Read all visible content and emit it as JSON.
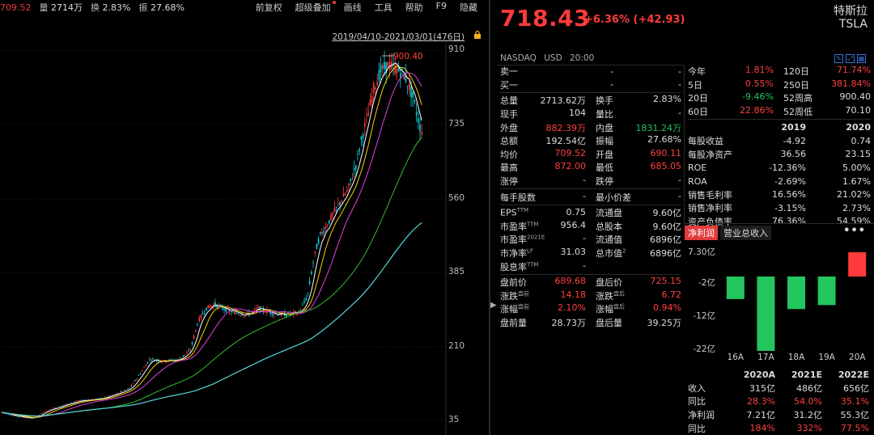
{
  "top_stats": [
    {
      "label": "",
      "value": "709.52",
      "tone": "red"
    },
    {
      "label": "量",
      "value": "2714万",
      "tone": "white"
    },
    {
      "label": "换",
      "value": "2.83%",
      "tone": "white"
    },
    {
      "label": "振",
      "value": "27.68%",
      "tone": "white"
    }
  ],
  "toolbar": [
    "前复权",
    "超级叠加",
    "画线",
    "工具",
    "帮助",
    "F9",
    "隐藏"
  ],
  "date_range": "2019/04/10-2021/03/01(476日)",
  "peak_label": "900.40",
  "price_axis": [
    "910",
    "735",
    "560",
    "385",
    "210",
    "35"
  ],
  "quote": {
    "price": "718.43",
    "change": "+6.36% (+42.93)",
    "name_cn": "特斯拉",
    "ticker": "TSLA",
    "exchange": "NASDAQ",
    "currency": "USD",
    "time": "20:00"
  },
  "icons_right": [
    "edit-icon",
    "chart-icon",
    "settings-icon"
  ],
  "bid_ask": [
    {
      "label": "卖一",
      "v1": "-",
      "v2": "-"
    },
    {
      "label": "买一",
      "v1": "-",
      "v2": "-"
    }
  ],
  "stats_left": [
    [
      {
        "l": "总量",
        "v": "2713.62万",
        "t": "white"
      },
      {
        "l": "换手",
        "v": "2.83%",
        "t": "white"
      }
    ],
    [
      {
        "l": "现手",
        "v": "104",
        "t": "white"
      },
      {
        "l": "量比",
        "v": "-",
        "t": "white"
      }
    ],
    [
      {
        "l": "外盘",
        "v": "882.39万",
        "t": "red"
      },
      {
        "l": "内盘",
        "v": "1831.24万",
        "t": "green"
      }
    ],
    [
      {
        "l": "总额",
        "v": "192.54亿",
        "t": "white"
      },
      {
        "l": "振幅",
        "v": "27.68%",
        "t": "white"
      }
    ],
    [
      {
        "l": "均价",
        "v": "709.52",
        "t": "red"
      },
      {
        "l": "开盘",
        "v": "690.11",
        "t": "red"
      }
    ],
    [
      {
        "l": "最高",
        "v": "872.00",
        "t": "red"
      },
      {
        "l": "最低",
        "v": "685.05",
        "t": "red"
      }
    ],
    [
      {
        "l": "涨停",
        "v": "-",
        "t": "white"
      },
      {
        "l": "跌停",
        "v": "-",
        "t": "white"
      }
    ]
  ],
  "lot_row": [
    {
      "l": "每手股数",
      "v": "-",
      "t": "white"
    },
    {
      "l": "最小价差",
      "v": "-",
      "t": "white"
    }
  ],
  "fund_rows": [
    [
      {
        "l": "EPS",
        "sup": "TTM",
        "v": "0.75",
        "t": "white"
      },
      {
        "l": "流通盘",
        "sup": "",
        "v": "9.60亿",
        "t": "white"
      }
    ],
    [
      {
        "l": "市盈率",
        "sup": "TTM",
        "v": "956.4",
        "t": "white"
      },
      {
        "l": "总股本",
        "sup": "",
        "v": "9.60亿",
        "t": "white"
      }
    ],
    [
      {
        "l": "市盈率",
        "sup": "2021E",
        "v": "-",
        "t": "white"
      },
      {
        "l": "流通值",
        "sup": "",
        "v": "6896亿",
        "t": "white"
      }
    ],
    [
      {
        "l": "市净率",
        "sup": "LF",
        "v": "31.03",
        "t": "white"
      },
      {
        "l": "总市值",
        "sup": "2",
        "v": "6896亿",
        "t": "white"
      }
    ],
    [
      {
        "l": "股息率",
        "sup": "TTM",
        "v": "-",
        "t": "white"
      },
      {
        "l": "",
        "sup": "",
        "v": "",
        "t": "white"
      }
    ]
  ],
  "extended_rows": [
    [
      {
        "l": "盘前价",
        "sup": "",
        "v": "689.68",
        "t": "red"
      },
      {
        "l": "盘后价",
        "sup": "",
        "v": "725.15",
        "t": "red"
      }
    ],
    [
      {
        "l": "涨跌",
        "sup": "盘前",
        "v": "14.18",
        "t": "red"
      },
      {
        "l": "涨跌",
        "sup": "盘后",
        "v": "6.72",
        "t": "red"
      }
    ],
    [
      {
        "l": "涨幅",
        "sup": "盘前",
        "v": "2.10%",
        "t": "red"
      },
      {
        "l": "涨幅",
        "sup": "盘后",
        "v": "0.94%",
        "t": "red"
      }
    ],
    [
      {
        "l": "盘前量",
        "sup": "",
        "v": "28.73万",
        "t": "white"
      },
      {
        "l": "盘后量",
        "sup": "",
        "v": "39.25万",
        "t": "white"
      }
    ]
  ],
  "perf_rows": [
    [
      {
        "l": "今年",
        "v": "1.81%",
        "t": "red"
      },
      {
        "l": "120日",
        "v": "71.74%",
        "t": "red"
      }
    ],
    [
      {
        "l": "5日",
        "v": "0.55%",
        "t": "red"
      },
      {
        "l": "250日",
        "v": "381.84%",
        "t": "red"
      }
    ],
    [
      {
        "l": "20日",
        "v": "-9.46%",
        "t": "green"
      },
      {
        "l": "52周高",
        "v": "900.40",
        "t": "white"
      }
    ],
    [
      {
        "l": "60日",
        "v": "22.86%",
        "t": "red"
      },
      {
        "l": "52周低",
        "v": "70.10",
        "t": "white"
      }
    ]
  ],
  "fin_table": {
    "years": [
      "2019",
      "2020"
    ],
    "rows": [
      {
        "l": "每股收益",
        "a": "-4.92",
        "b": "0.74"
      },
      {
        "l": "每股净资产",
        "a": "36.56",
        "b": "23.15"
      },
      {
        "l": "ROE",
        "a": "-12.36%",
        "b": "5.00%"
      },
      {
        "l": "ROA",
        "a": "-2.69%",
        "b": "1.67%"
      },
      {
        "l": "销售毛利率",
        "a": "16.56%",
        "b": "21.02%"
      },
      {
        "l": "销售净利率",
        "a": "-3.15%",
        "b": "2.73%"
      },
      {
        "l": "资产负债率",
        "a": "76.36%",
        "b": "54.59%"
      }
    ]
  },
  "fin_tabs": [
    "净利润",
    "营业总收入"
  ],
  "more_label": "•••",
  "chart_data": {
    "type": "bar",
    "title": "",
    "categories": [
      "16A",
      "17A",
      "18A",
      "19A",
      "20A"
    ],
    "values": [
      -6.8,
      -22.4,
      -9.8,
      -8.6,
      7.3
    ],
    "yticks": [
      "7.30亿",
      "-2亿",
      "-12亿",
      "-22亿"
    ],
    "ylim": [
      -22.4,
      7.3
    ],
    "colors": {
      "positive": "#ff3b3b",
      "negative": "#22c55e"
    }
  },
  "forecast": {
    "years": [
      "2020A",
      "2021E",
      "2022E"
    ],
    "rows": [
      {
        "l": "收入",
        "v": [
          "315亿",
          "486亿",
          "656亿"
        ],
        "t": "white"
      },
      {
        "l": "同比",
        "v": [
          "28.3%",
          "54.0%",
          "35.1%"
        ],
        "t": "red"
      },
      {
        "l": "净利润",
        "v": [
          "7.21亿",
          "31.2亿",
          "55.3亿"
        ],
        "t": "white"
      },
      {
        "l": "同比",
        "v": [
          "184%",
          "332%",
          "77.5%"
        ],
        "t": "red"
      }
    ]
  }
}
